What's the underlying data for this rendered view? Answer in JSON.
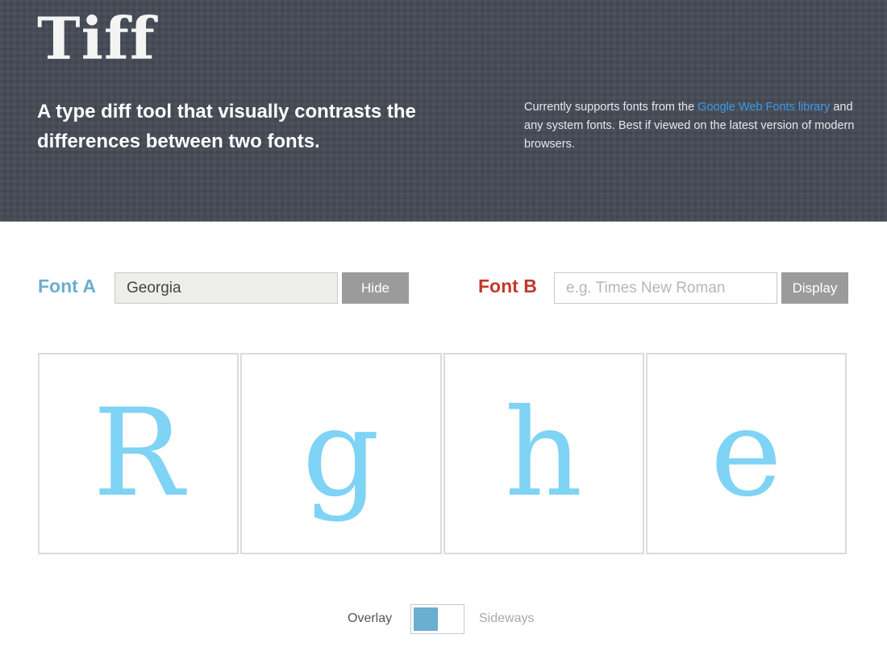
{
  "header": {
    "logo": "Tiff",
    "tagline": "A type diff tool that visually contrasts the differences between two fonts.",
    "support_prefix": "Currently supports fonts from the ",
    "support_link": "Google Web Fonts library",
    "support_suffix": " and any system fonts. Best if viewed on the latest version of modern browsers."
  },
  "font_a": {
    "label": "Font A",
    "value": "Georgia",
    "placeholder": "",
    "button": "Hide",
    "color": "#6aaed0"
  },
  "font_b": {
    "label": "Font B",
    "value": "",
    "placeholder": "e.g. Times New Roman",
    "button": "Display",
    "color": "#c0392b"
  },
  "glyphs": [
    "R",
    "g",
    "h",
    "e"
  ],
  "glyph_color": "#7fd3f4",
  "view_toggle": {
    "left_label": "Overlay",
    "right_label": "Sideways",
    "selected": "Overlay"
  }
}
